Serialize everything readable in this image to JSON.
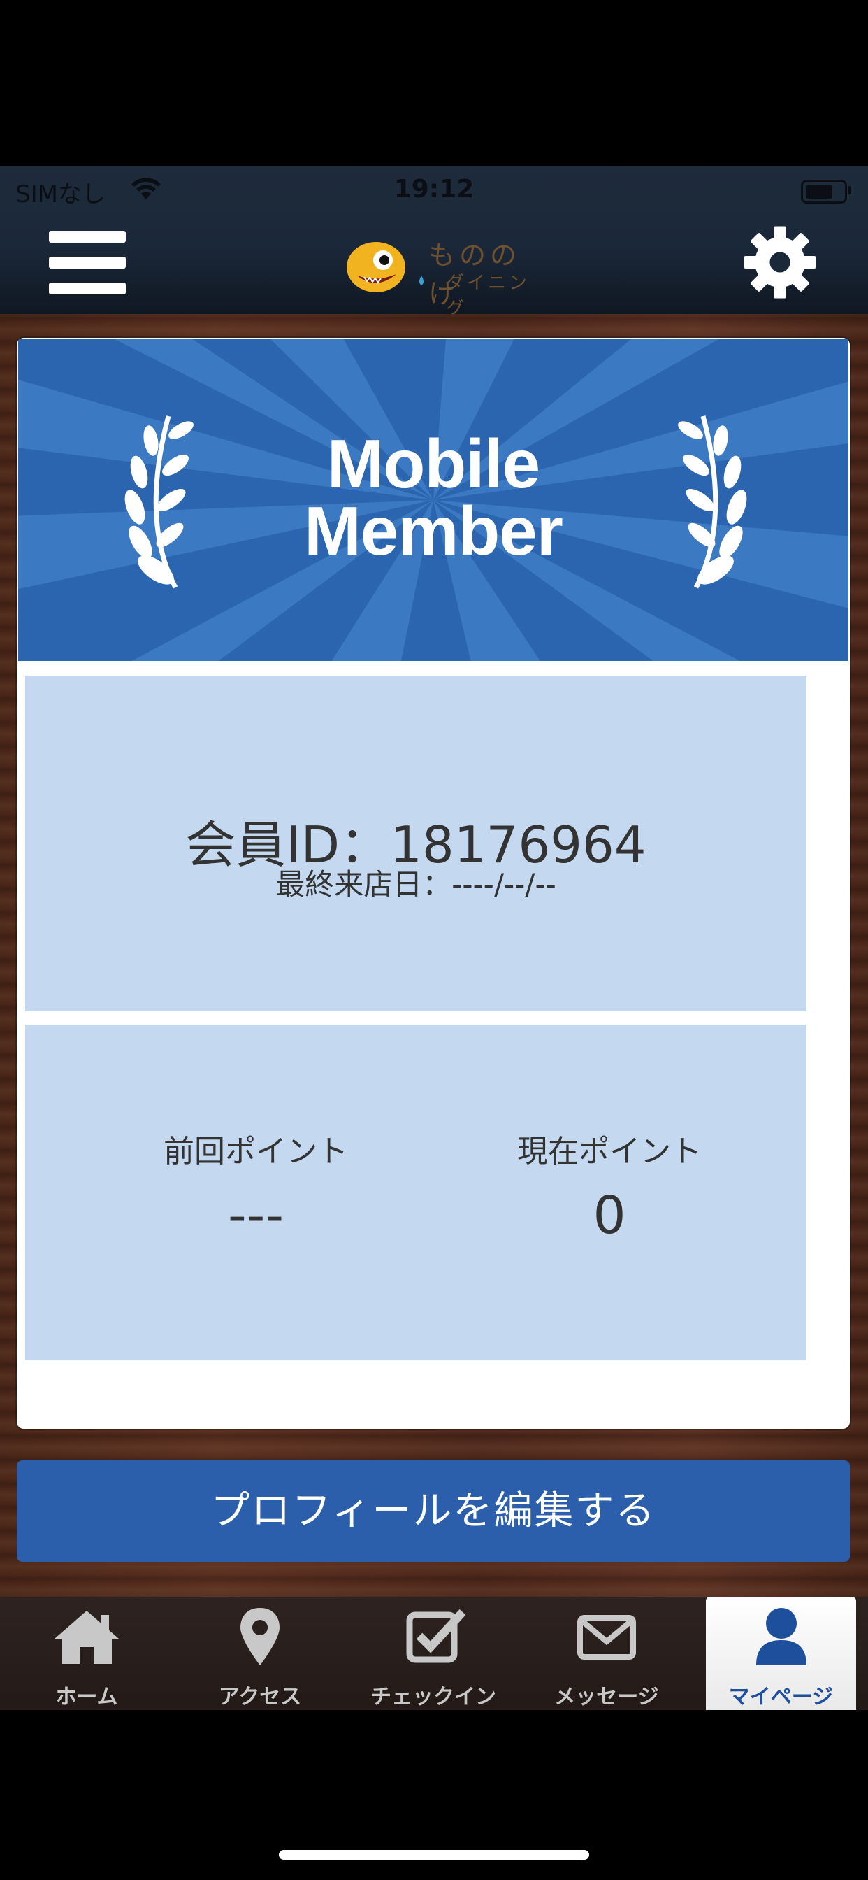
{
  "status_bar": {
    "carrier": "SIMなし",
    "time": "19:12"
  },
  "header": {
    "logo_line1": "もののけ",
    "logo_line2": "ダイニング",
    "menu_icon": "hamburger-icon",
    "settings_icon": "gear-icon"
  },
  "banner": {
    "title_line1": "Mobile",
    "title_line2": "Member"
  },
  "member": {
    "id_text": "会員ID：18176964",
    "last_visit_text": "最終来店日：----/--/--"
  },
  "points": {
    "previous_label": "前回ポイント",
    "previous_value": "---",
    "current_label": "現在ポイント",
    "current_value": "0"
  },
  "edit_profile_button": "プロフィールを編集する",
  "tabbar": {
    "items": [
      {
        "label": "ホーム",
        "icon": "home-icon"
      },
      {
        "label": "アクセス",
        "icon": "map-pin-icon"
      },
      {
        "label": "チェックイン",
        "icon": "checkbox-icon"
      },
      {
        "label": "メッセージ",
        "icon": "envelope-icon"
      },
      {
        "label": "マイページ",
        "icon": "person-icon",
        "active": true
      }
    ]
  },
  "colors": {
    "brand_blue": "#2b5fab",
    "panel_blue": "#c4d9f0",
    "header_navy": "#1b2839"
  }
}
